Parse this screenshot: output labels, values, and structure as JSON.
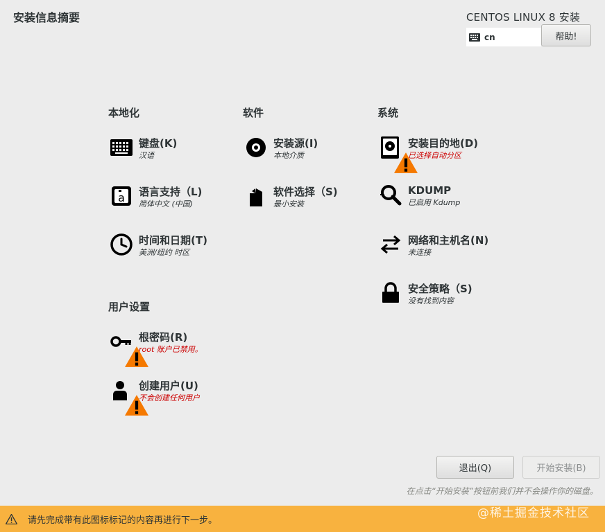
{
  "header": {
    "page_title": "安装信息摘要",
    "product_title": "CENTOS LINUX 8 安装",
    "keyboard_layout": "cn",
    "help_label": "帮助!"
  },
  "sections": {
    "localization": {
      "title": "本地化",
      "keyboard": {
        "label": "键盘(K)",
        "status": "汉语",
        "icon": "keyboard-icon"
      },
      "language": {
        "label": "语言支持（L)",
        "status": "简体中文 (中国)",
        "icon": "language-icon"
      },
      "time": {
        "label": "时间和日期(T)",
        "status": "美洲/纽约 时区",
        "icon": "clock-icon"
      }
    },
    "software": {
      "title": "软件",
      "source": {
        "label": "安装源(I)",
        "status": "本地介质",
        "icon": "disc-icon"
      },
      "selection": {
        "label": "软件选择（S)",
        "status": "最小安装",
        "icon": "package-icon"
      }
    },
    "system": {
      "title": "系统",
      "destination": {
        "label": "安装目的地(D)",
        "status": "已选择自动分区",
        "icon": "harddisk-icon"
      },
      "kdump": {
        "label": "KDUMP",
        "status": "已启用 Kdump",
        "icon": "magnifier-icon"
      },
      "network": {
        "label": "网络和主机名(N)",
        "status": "未连接",
        "icon": "network-arrows-icon"
      },
      "security": {
        "label": "安全策略（S)",
        "status": "没有找到内容",
        "icon": "lock-icon"
      }
    },
    "user": {
      "title": "用户设置",
      "root": {
        "label": "根密码(R)",
        "status": "root 账户已禁用。",
        "icon": "key-icon"
      },
      "create_user": {
        "label": "创建用户(U)",
        "status": "不会创建任何用户",
        "icon": "user-icon"
      }
    }
  },
  "footer": {
    "quit_label": "退出(Q)",
    "begin_label": "开始安装(B)",
    "hint": "在点击“开始安装”按钮前我们并不会操作你的磁盘。",
    "warning": "请先完成带有此图标标记的内容再进行下一步。",
    "watermark": "@稀土掘金技术社区"
  },
  "colors": {
    "background": "#ececec",
    "warning_bar": "#f8b23f",
    "warning_text": "#cc0000",
    "text": "#2e3436"
  }
}
